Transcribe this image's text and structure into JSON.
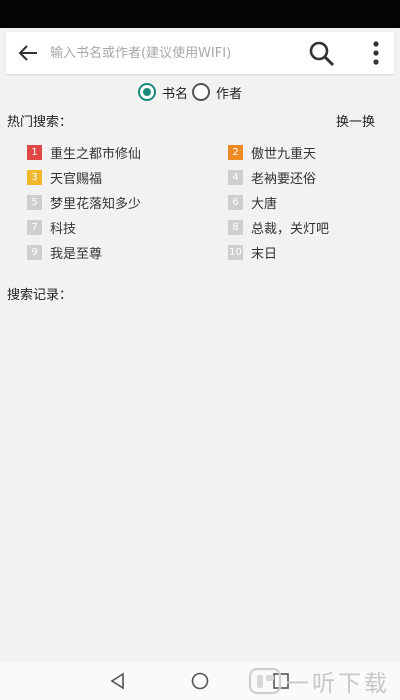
{
  "search": {
    "placeholder": "输入书名或作者(建议使用WIFI)",
    "value": ""
  },
  "search_type": {
    "options": [
      {
        "label": "书名",
        "checked": true
      },
      {
        "label": "作者",
        "checked": false
      }
    ]
  },
  "hot_search": {
    "title": "热门搜索：",
    "refresh_label": "换一换",
    "items": [
      {
        "rank": "1",
        "label": "重生之都市修仙",
        "color": "#e04848"
      },
      {
        "rank": "2",
        "label": "傲世九重天",
        "color": "#f08a24"
      },
      {
        "rank": "3",
        "label": "天官赐福",
        "color": "#f0b82c"
      },
      {
        "rank": "4",
        "label": "老衲要还俗",
        "color": "#cfcfcf"
      },
      {
        "rank": "5",
        "label": "梦里花落知多少",
        "color": "#cfcfcf"
      },
      {
        "rank": "6",
        "label": "大唐",
        "color": "#cfcfcf"
      },
      {
        "rank": "7",
        "label": "科技",
        "color": "#cfcfcf"
      },
      {
        "rank": "8",
        "label": "总裁，关灯吧",
        "color": "#cfcfcf"
      },
      {
        "rank": "9",
        "label": "我是至尊",
        "color": "#cfcfcf"
      },
      {
        "rank": "10",
        "label": "末日",
        "color": "#cfcfcf"
      }
    ]
  },
  "history": {
    "title": "搜索记录："
  },
  "watermark": {
    "text": "一听下载"
  },
  "colors": {
    "accent": "#1b8a7a",
    "background": "#f2f2f2"
  }
}
